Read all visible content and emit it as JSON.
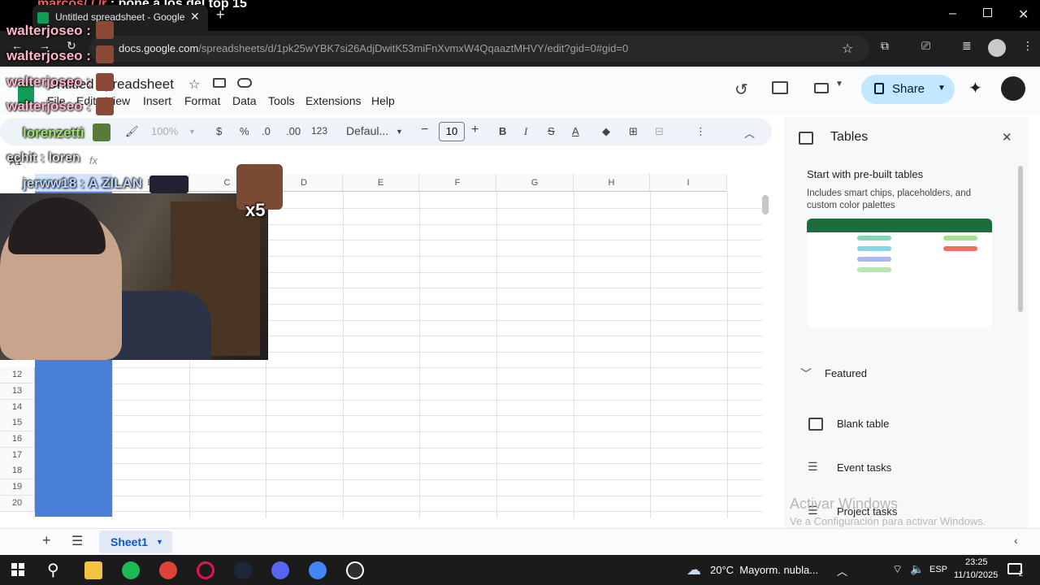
{
  "browser": {
    "tab_title": "Untitled spreadsheet - Google",
    "url_host": "docs.google.com",
    "url_path": "/spreadsheets/d/1pk25wYBK7si26AdjDwitK53miFnXvmxW4QqaaztMHVY/edit?gid=0#gid=0"
  },
  "sheet": {
    "title": "Untitled spreadsheet",
    "share_label": "Share",
    "menus": [
      "File",
      "Edit",
      "View",
      "Insert",
      "Format",
      "Data",
      "Tools",
      "Extensions",
      "Help"
    ],
    "zoom": "100%",
    "currency": "$",
    "percent": "%",
    "dec_less": ".0",
    "dec_more": ".00",
    "number_format": "123",
    "font": "Defaul...",
    "font_size": "10",
    "cell_ref": "A1",
    "fx": "fx",
    "columns": [
      "A",
      "B",
      "C",
      "D",
      "E",
      "F",
      "G",
      "H",
      "I"
    ],
    "rows": [
      "12",
      "13",
      "14",
      "15",
      "16",
      "17",
      "18",
      "19",
      "20"
    ],
    "sheet_tab": "Sheet1"
  },
  "panel": {
    "title": "Tables",
    "heading": "Start with pre-built tables",
    "description": "Includes smart chips, placeholders, and custom color palettes",
    "featured": "Featured",
    "items": [
      "Blank table",
      "Event tasks",
      "Project tasks"
    ]
  },
  "windows": {
    "activate_title": "Activar Windows",
    "activate_sub": "Ve a Configuración para activar Windows.",
    "weather": "20°C  Mayorm. nubla...",
    "lang": "ESP",
    "time": "23:25",
    "date": "11/10/2025",
    "notif_count": "2"
  },
  "stream": {
    "top_message_user": "marcos/ / /r",
    "top_message_text": ": pone a los del top 15",
    "chat_users": [
      "walterjoseo :",
      "walterjoseo :",
      "walterjoseo :",
      "walterjoseo :"
    ],
    "chat_lorenzo": "lorenzetti",
    "chat_echit": "echit : loren",
    "chat_jerww": "jerww18 : A ZILAN",
    "emote_count": "x5"
  }
}
